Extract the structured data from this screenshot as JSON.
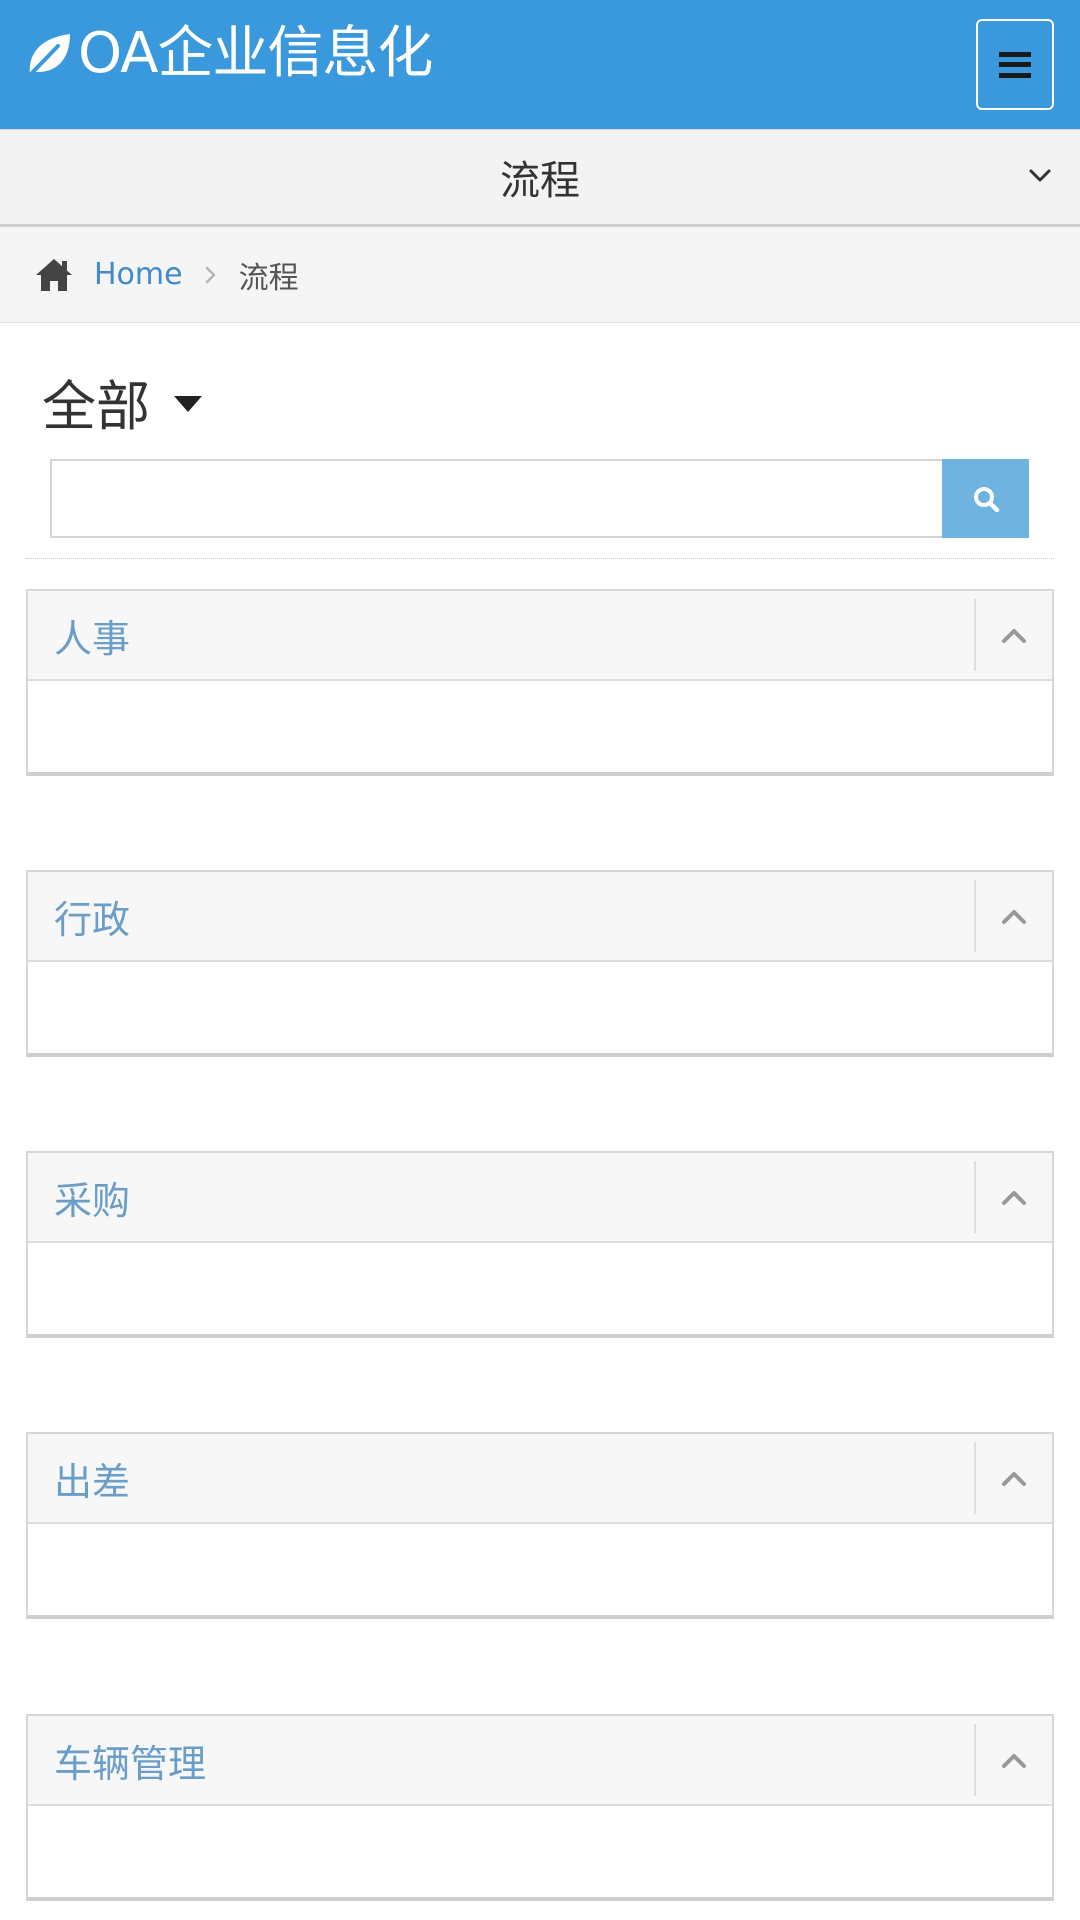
{
  "header": {
    "brand_text": "OA企业信息化",
    "brand_icon": "leaf-icon",
    "menu_icon": "hamburger-icon",
    "bg_color": "#3a98dc"
  },
  "section": {
    "title": "流程",
    "chevron_icon": "chevron-down-icon"
  },
  "breadcrumb": {
    "home_icon": "home-icon",
    "home_label": "Home",
    "current": "流程"
  },
  "filter": {
    "label": "全部",
    "caret_icon": "caret-down-icon"
  },
  "search": {
    "value": "",
    "placeholder": "",
    "button_icon": "search-icon",
    "button_color": "#6fb3e0"
  },
  "categories": [
    {
      "title": "人事"
    },
    {
      "title": "行政"
    },
    {
      "title": "采购"
    },
    {
      "title": "出差"
    },
    {
      "title": "车辆管理"
    }
  ]
}
